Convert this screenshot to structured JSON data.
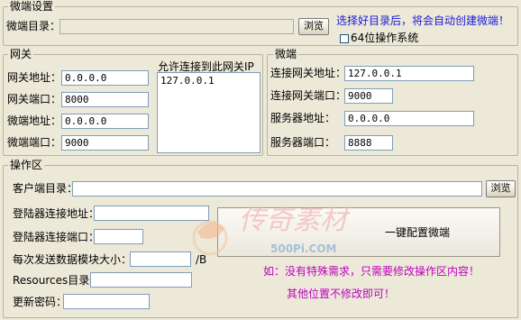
{
  "weiduan_settings": {
    "title": "微端设置",
    "dir_label": "微端目录：",
    "dir_value": "",
    "browse": "浏览",
    "hint": "选择好目录后，将会自动创建微端！",
    "checkbox_label": "64位操作系统",
    "checkbox_checked": false
  },
  "gateway": {
    "title": "网关",
    "addr_label": "网关地址：",
    "addr_value": "0.0.0.0",
    "port_label": "网关端口：",
    "port_value": "8000",
    "wd_addr_label": "微端地址：",
    "wd_addr_value": "0.0.0.0",
    "wd_port_label": "微端端口：",
    "wd_port_value": "9000",
    "allow_ip_label": "允许连接到此网关IP",
    "allow_ip_value": "127.0.0.1"
  },
  "weiduan": {
    "title": "微端",
    "conn_gw_addr_label": "连接网关地址：",
    "conn_gw_addr_value": "127.0.0.1",
    "conn_gw_port_label": "连接网关端口：",
    "conn_gw_port_value": "9000",
    "server_addr_label": "服务器地址：",
    "server_addr_value": "0.0.0.0",
    "server_port_label": "服务器端口：",
    "server_port_value": "8888"
  },
  "ops": {
    "title": "操作区",
    "client_dir_label": "客户端目录：",
    "client_dir_value": "",
    "browse": "浏览",
    "login_addr_label": "登陆器连接地址：",
    "login_addr_value": "",
    "login_port_label": "登陆器连接端口：",
    "login_port_value": "",
    "send_size_label": "每次发送数据模块大小：",
    "send_size_value": "",
    "send_size_unit": "/B",
    "resources_label": "Resources目录：",
    "resources_value": "",
    "password_label": "更新密码：",
    "password_value": "",
    "config_button": "一键配置微端",
    "note1": "如：没有特殊需求，只需要修改操作区内容！",
    "note2": "其他位置不修改即可！"
  },
  "watermark": {
    "text": "传奇素材",
    "url": "500Pi.COM"
  }
}
